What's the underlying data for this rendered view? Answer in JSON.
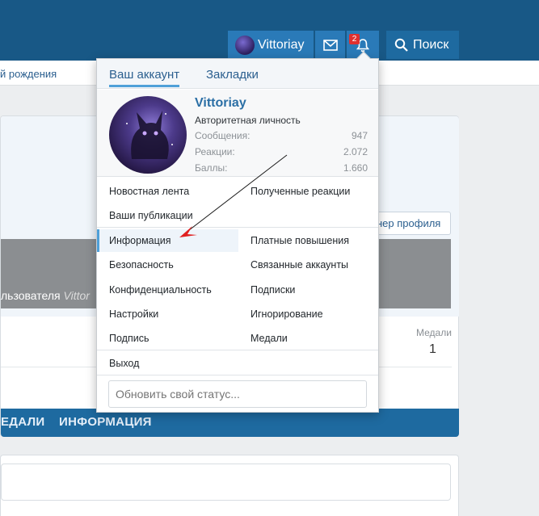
{
  "header": {
    "user_name": "Vittoriay",
    "notifications_count": "2",
    "search_label": "Поиск"
  },
  "subbar": {
    "text": "й рождения"
  },
  "background": {
    "banner_button": "нер профиля",
    "grey_text_prefix": "льзователя",
    "grey_text_name": "Vittor",
    "medals_label": "Медали",
    "medals_value": "1",
    "tabs": [
      "ЕДАЛИ",
      "ИНФОРМАЦИЯ"
    ]
  },
  "menu": {
    "tabs": [
      "Ваш аккаунт",
      "Закладки"
    ],
    "account": {
      "name": "Vittoriay",
      "title": "Авторитетная личность",
      "stats": [
        {
          "label": "Сообщения:",
          "value": "947"
        },
        {
          "label": "Реакции:",
          "value": "2.072"
        },
        {
          "label": "Баллы:",
          "value": "1.660"
        }
      ]
    },
    "items": {
      "news_feed": "Новостная лента",
      "reactions_received": "Полученные реакции",
      "your_posts": "Ваши публикации",
      "information": "Информация",
      "paid_upgrades": "Платные повышения",
      "security": "Безопасность",
      "connected_accounts": "Связанные аккаунты",
      "privacy": "Конфиденциальность",
      "subscriptions": "Подписки",
      "settings": "Настройки",
      "ignoring": "Игнорирование",
      "signature": "Подпись",
      "medals": "Медали",
      "logout": "Выход"
    },
    "status_placeholder": "Обновить свой статус..."
  },
  "colors": {
    "header": "#185886",
    "accent": "#4fa0d8",
    "link": "#2b5f8f",
    "annotation_arrow": "#e02020"
  }
}
